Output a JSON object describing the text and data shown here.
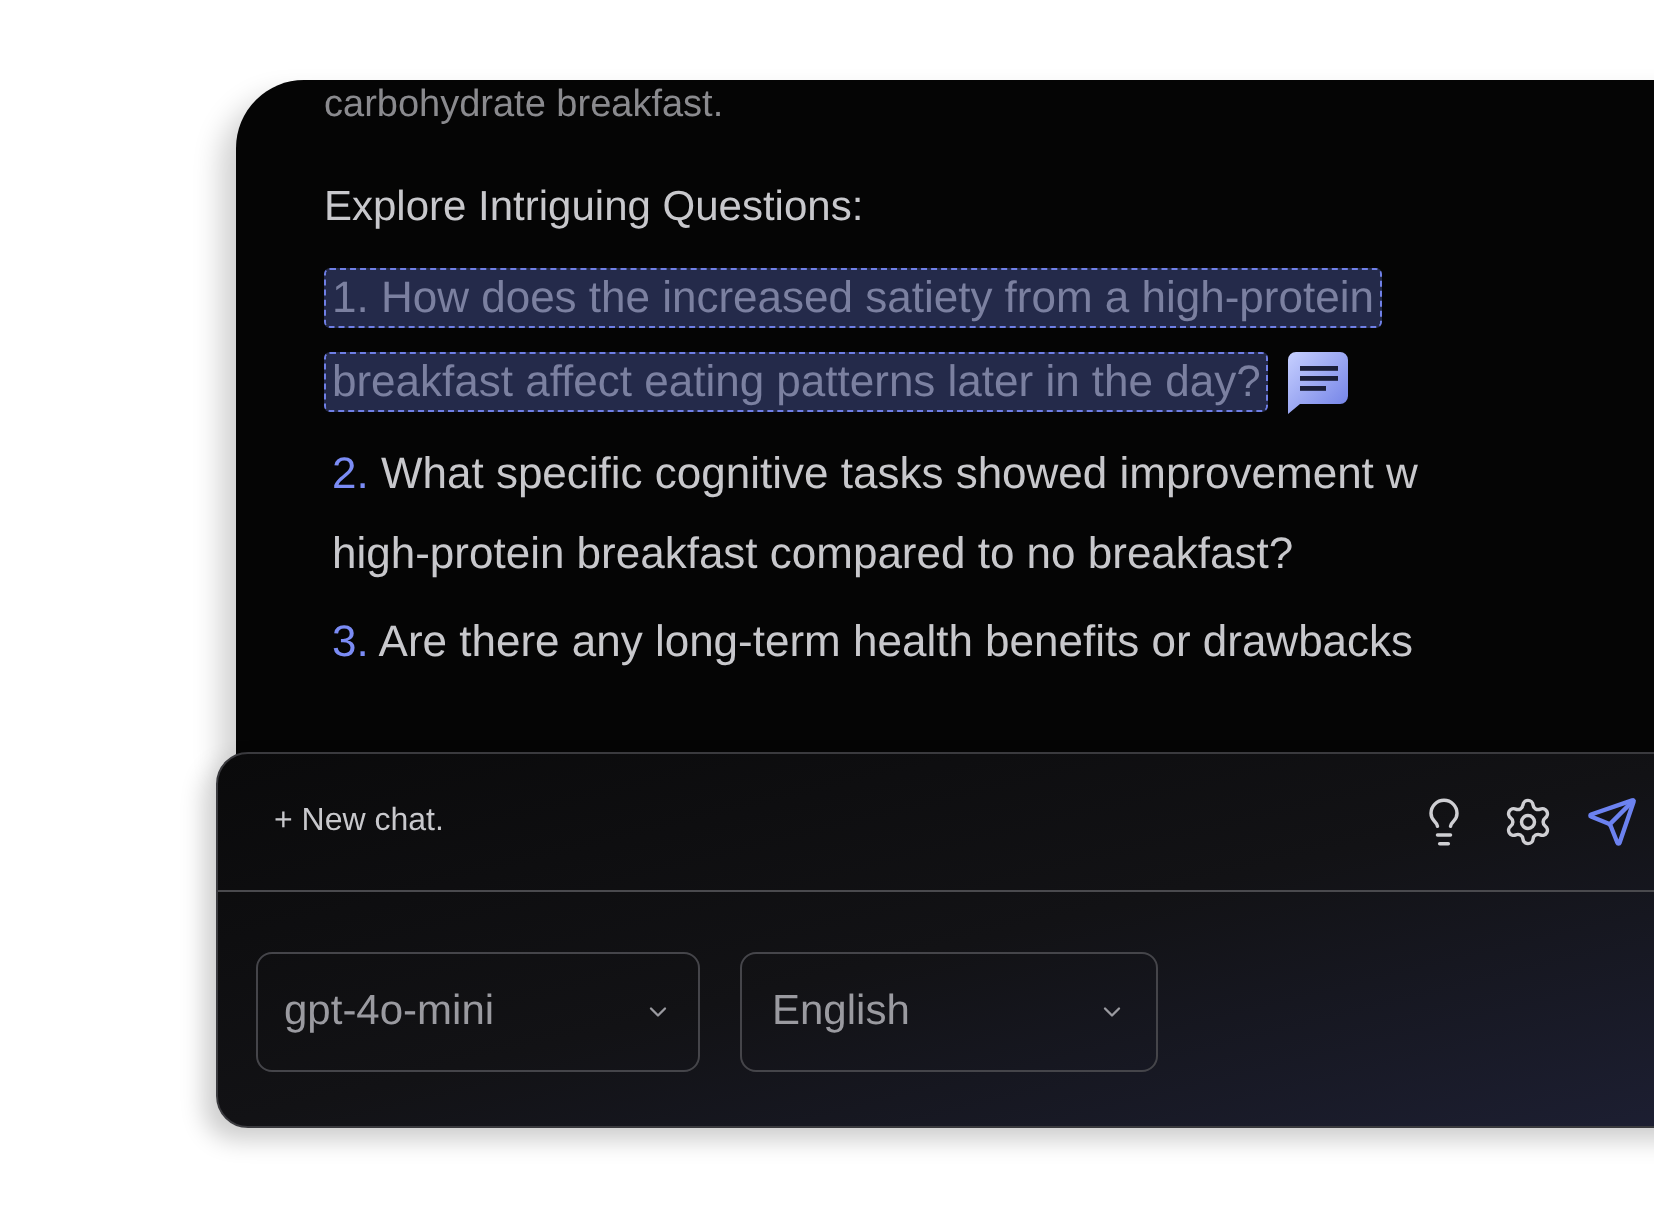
{
  "previous_text": "carbohydrate breakfast.",
  "section_heading": "Explore Intriguing Questions:",
  "questions": [
    {
      "number": "1.",
      "lines": [
        "How does the increased satiety from a high-protein",
        "breakfast affect eating patterns later in the day?"
      ],
      "selected": true
    },
    {
      "number": "2.",
      "lines": [
        "What specific cognitive tasks showed improvement w",
        "high-protein breakfast compared to no breakfast?"
      ],
      "selected": false
    },
    {
      "number": "3.",
      "lines": [
        "Are there any long-term health benefits or drawbacks"
      ],
      "selected": false
    }
  ],
  "composer": {
    "new_chat": "+ New chat.",
    "model_select": "gpt-4o-mini",
    "language_select": "English"
  }
}
